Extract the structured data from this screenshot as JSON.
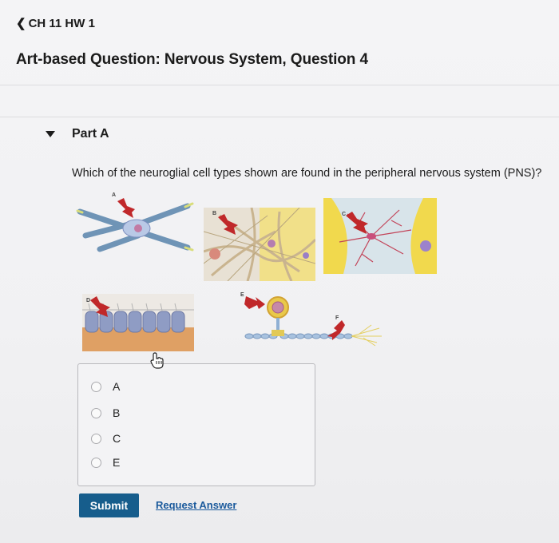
{
  "header": {
    "back_label": "CH 11 HW 1",
    "back_icon": "chevron-left-icon"
  },
  "page_title": "Art-based Question: Nervous System, Question 4",
  "part": {
    "label": "Part A",
    "toggle_icon": "caret-down-icon"
  },
  "question": "Which of the neuroglial cell types shown are found in the peripheral nervous system (PNS)?",
  "figures": [
    {
      "letter": "A"
    },
    {
      "letter": "B"
    },
    {
      "letter": "C"
    },
    {
      "letter": "D"
    },
    {
      "letter": "E"
    },
    {
      "letter": "F"
    }
  ],
  "answer_options": [
    {
      "label": "A",
      "selected": false
    },
    {
      "label": "B",
      "selected": false
    },
    {
      "label": "C",
      "selected": false
    },
    {
      "label": "E",
      "selected": false
    }
  ],
  "actions": {
    "submit_label": "Submit",
    "request_answer_label": "Request Answer"
  },
  "colors": {
    "accent_blue": "#165d8c",
    "link_blue": "#1b5a9c",
    "arrow_red": "#c0282a"
  }
}
